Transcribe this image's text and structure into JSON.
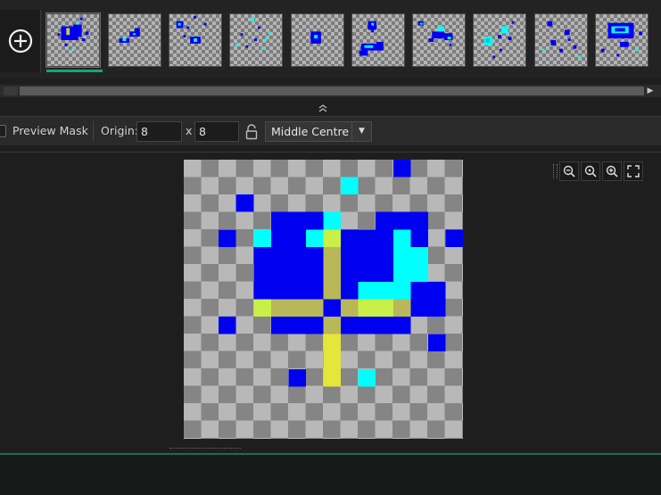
{
  "frames": {
    "count": 10,
    "selected_index": 0,
    "add_label": "add-frame"
  },
  "scrollbar": {
    "right_arrow": "▶"
  },
  "collapse": {
    "glyph": "⌃"
  },
  "toolbar": {
    "preview_mask_label": "Preview Mask",
    "preview_mask_checked": false,
    "origin_label": "Origin:",
    "origin_x": "8",
    "origin_sep": "x",
    "origin_y": "8",
    "origin_mode": "Middle Centre",
    "dropdown_arrow": "▼"
  },
  "zoom_tools": {
    "icons": [
      "zoom-out-icon",
      "zoom-reset-icon",
      "zoom-in-icon",
      "fullscreen-icon"
    ]
  },
  "colors": {
    "blue": "#0000f0",
    "cyan": "#00ffff",
    "yellow": "#e6e63a",
    "yellow_green": "#c8f046",
    "olive": "#b8b858",
    "accent": "#1aa37a"
  }
}
